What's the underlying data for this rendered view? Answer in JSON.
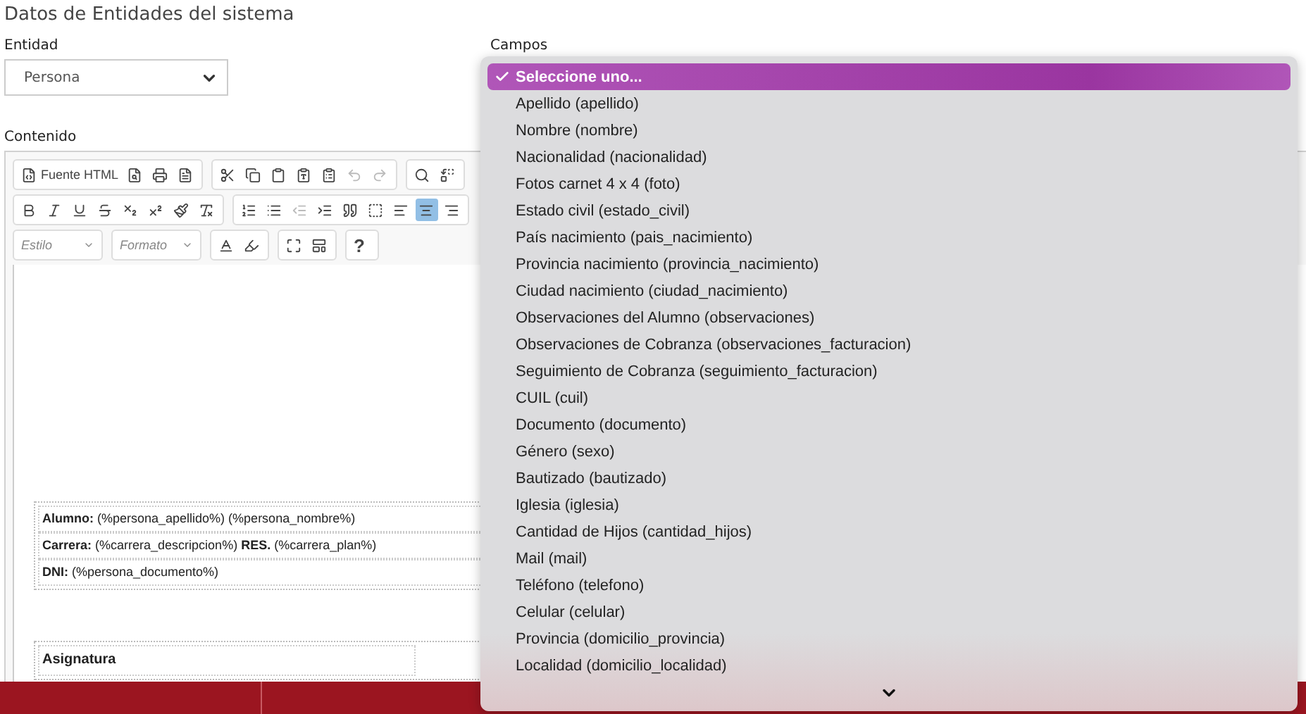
{
  "page_title": "Datos de Entidades del sistema",
  "entity": {
    "label": "Entidad",
    "value": "Persona"
  },
  "fields": {
    "label": "Campos"
  },
  "content_label": "Contenido",
  "toolbar": [
    [
      [
        {
          "kind": "source",
          "label": "Fuente HTML"
        },
        {
          "kind": "preview"
        },
        {
          "kind": "print"
        },
        {
          "kind": "template"
        }
      ],
      [
        {
          "kind": "cut"
        },
        {
          "kind": "copy"
        },
        {
          "kind": "paste"
        },
        {
          "kind": "paste-text"
        },
        {
          "kind": "paste-word"
        },
        {
          "kind": "undo",
          "disabled": true
        },
        {
          "kind": "redo",
          "disabled": true
        }
      ],
      [
        {
          "kind": "find"
        },
        {
          "kind": "replace"
        }
      ]
    ],
    [
      [
        {
          "kind": "bold"
        },
        {
          "kind": "italic"
        },
        {
          "kind": "underline"
        },
        {
          "kind": "strike"
        },
        {
          "kind": "subscript"
        },
        {
          "kind": "superscript"
        },
        {
          "kind": "brush"
        },
        {
          "kind": "clear-format"
        }
      ],
      [
        {
          "kind": "numbered-list"
        },
        {
          "kind": "bullet-list"
        },
        {
          "kind": "outdent",
          "disabled": true
        },
        {
          "kind": "indent"
        },
        {
          "kind": "quote"
        },
        {
          "kind": "div"
        },
        {
          "kind": "align-left",
          "selected": false
        },
        {
          "kind": "align-center",
          "selected": true
        },
        {
          "kind": "align-right",
          "selected": false
        }
      ]
    ],
    [
      [
        {
          "kind": "combo",
          "label": "Estilo"
        }
      ],
      [
        {
          "kind": "combo",
          "label": "Formato"
        }
      ],
      [
        {
          "kind": "text-color"
        },
        {
          "kind": "bg-color"
        }
      ],
      [
        {
          "kind": "maximize"
        },
        {
          "kind": "blocks"
        }
      ],
      [
        {
          "kind": "help",
          "label": "?"
        }
      ]
    ]
  ],
  "info_table": [
    "**Alumno:** (%persona_apellido%) (%persona_nombre%)",
    "**Carrera:** (%carrera_descripcion%) **RES.**  (%carrera_plan%)",
    "**DNI:** (%persona_documento%)"
  ],
  "subjects_table": {
    "header": "Asignatura"
  },
  "dropdown": [
    {
      "label": "Seleccione uno...",
      "selected": true
    },
    {
      "label": "Apellido (apellido)",
      "selected": false
    },
    {
      "label": "Nombre (nombre)",
      "selected": false
    },
    {
      "label": "Nacionalidad (nacionalidad)",
      "selected": false
    },
    {
      "label": "Fotos carnet 4 x 4 (foto)",
      "selected": false
    },
    {
      "label": "Estado civil (estado_civil)",
      "selected": false
    },
    {
      "label": "País nacimiento (pais_nacimiento)",
      "selected": false
    },
    {
      "label": "Provincia nacimiento (provincia_nacimiento)",
      "selected": false
    },
    {
      "label": "Ciudad nacimiento (ciudad_nacimiento)",
      "selected": false
    },
    {
      "label": "Observaciones del Alumno (observaciones)",
      "selected": false
    },
    {
      "label": "Observaciones de Cobranza (observaciones_facturacion)",
      "selected": false
    },
    {
      "label": "Seguimiento de Cobranza (seguimiento_facturacion)",
      "selected": false
    },
    {
      "label": "CUIL (cuil)",
      "selected": false
    },
    {
      "label": "Documento (documento)",
      "selected": false
    },
    {
      "label": "Género (sexo)",
      "selected": false
    },
    {
      "label": "Bautizado (bautizado)",
      "selected": false
    },
    {
      "label": "Iglesia (iglesia)",
      "selected": false
    },
    {
      "label": "Cantidad de Hijos (cantidad_hijos)",
      "selected": false
    },
    {
      "label": "Mail (mail)",
      "selected": false
    },
    {
      "label": "Teléfono (telefono)",
      "selected": false
    },
    {
      "label": "Celular (celular)",
      "selected": false
    },
    {
      "label": "Provincia (domicilio_provincia)",
      "selected": false
    },
    {
      "label": "Localidad (domicilio_localidad)",
      "selected": false
    }
  ]
}
